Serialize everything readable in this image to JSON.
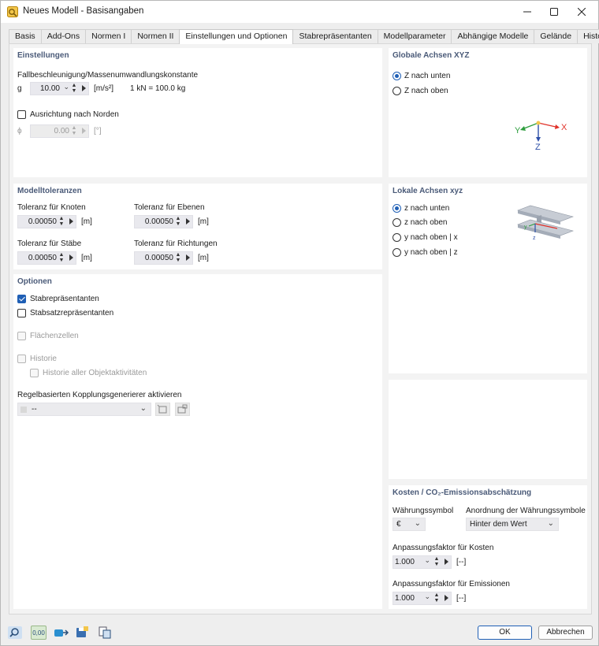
{
  "window": {
    "title": "Neues Modell - Basisangaben"
  },
  "tabs": [
    {
      "label": "Basis"
    },
    {
      "label": "Add-Ons"
    },
    {
      "label": "Normen I"
    },
    {
      "label": "Normen II"
    },
    {
      "label": "Einstellungen und Optionen"
    },
    {
      "label": "Stabrepräsentanten"
    },
    {
      "label": "Modellparameter"
    },
    {
      "label": "Abhängige Modelle"
    },
    {
      "label": "Gelände"
    },
    {
      "label": "Historie"
    }
  ],
  "active_tab": "Einstellungen und Optionen",
  "einstellungen": {
    "title": "Einstellungen",
    "gravity_label": "Fallbeschleunigung/Massenumwandlungskonstante",
    "g_symbol": "g",
    "g_value": "10.00",
    "g_unit": "[m/s²]",
    "conversion": "1 kN = 100.0 kg",
    "north_label": "Ausrichtung nach Norden",
    "north_checked": false,
    "phi_symbol": "ϕ",
    "phi_value": "0.00",
    "phi_unit": "[°]"
  },
  "global_axes": {
    "title": "Globale Achsen XYZ",
    "options": [
      "Z nach unten",
      "Z nach oben"
    ],
    "selected": "Z nach unten",
    "axis_x": "X",
    "axis_y": "Y",
    "axis_z": "Z",
    "colors": {
      "x": "#e0322a",
      "y": "#2e9e3e",
      "z": "#2d4fa8"
    }
  },
  "toleranzen": {
    "title": "Modelltoleranzen",
    "knoten_label": "Toleranz für Knoten",
    "knoten_value": "0.00050",
    "knoten_unit": "[m]",
    "ebenen_label": "Toleranz für Ebenen",
    "ebenen_value": "0.00050",
    "ebenen_unit": "[m]",
    "staebe_label": "Toleranz für Stäbe",
    "staebe_value": "0.00050",
    "staebe_unit": "[m]",
    "richtungen_label": "Toleranz für Richtungen",
    "richtungen_value": "0.00050",
    "richtungen_unit": "[m]"
  },
  "local_axes": {
    "title": "Lokale Achsen xyz",
    "options": [
      "z nach unten",
      "z nach oben",
      "y nach oben | x",
      "y nach oben | z"
    ],
    "selected": "z nach unten",
    "axis_y": "y",
    "axis_z": "z"
  },
  "optionen": {
    "title": "Optionen",
    "stabrep_label": "Stabrepräsentanten",
    "stabrep_checked": true,
    "stabsatz_label": "Stabsatzrepräsentanten",
    "stabsatz_checked": false,
    "flaechen_label": "Flächenzellen",
    "historie_label": "Historie",
    "historie_alle_label": "Historie aller Objektaktivitäten",
    "kopplung_label": "Regelbasierten Kopplungsgenerierer aktivieren",
    "kopplung_value": "--"
  },
  "kosten": {
    "title": "Kosten / CO₂-Emissionsabschätzung",
    "waehrung_label": "Währungssymbol",
    "waehrung_value": "€",
    "anordnung_label": "Anordnung der Währungssymbole",
    "anordnung_value": "Hinter dem Wert",
    "kosten_faktor_label": "Anpassungsfaktor für Kosten",
    "kosten_faktor_value": "1.000",
    "kosten_faktor_unit": "[--]",
    "emission_faktor_label": "Anpassungsfaktor für Emissionen",
    "emission_faktor_value": "1.000",
    "emission_faktor_unit": "[--]"
  },
  "buttons": {
    "ok": "OK",
    "cancel": "Abbrechen",
    "units_icon_text": "0,00"
  }
}
